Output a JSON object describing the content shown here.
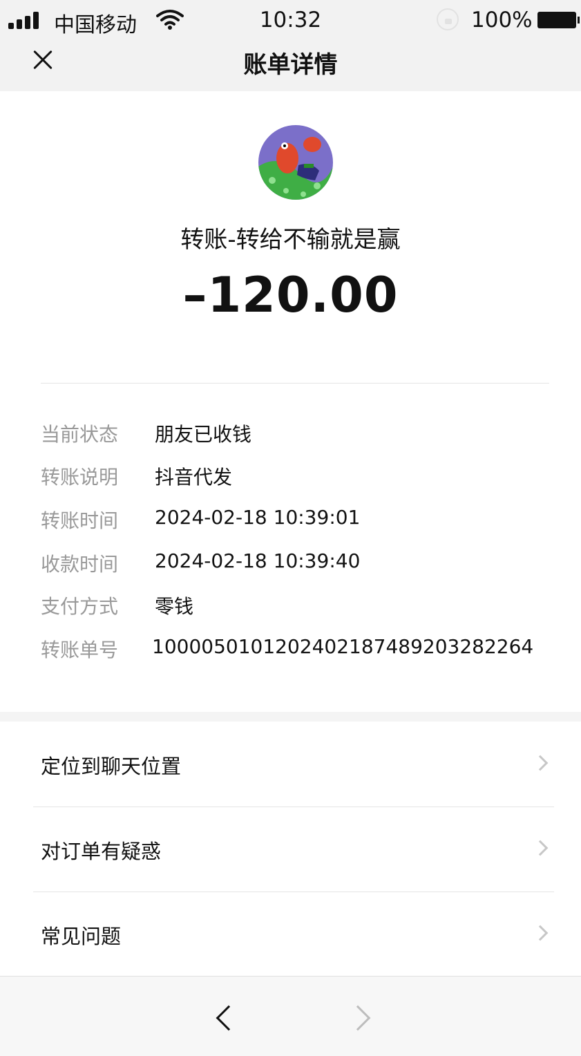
{
  "status_bar": {
    "carrier": "中国移动",
    "time": "10:32",
    "battery_percent": "100%"
  },
  "nav": {
    "title": "账单详情"
  },
  "header": {
    "payee": "转账-转给不输就是赢",
    "amount": "–120.00"
  },
  "details": [
    {
      "label": "当前状态",
      "value": "朋友已收钱"
    },
    {
      "label": "转账说明",
      "value": "抖音代发"
    },
    {
      "label": "转账时间",
      "value": "2024-02-18 10:39:01"
    },
    {
      "label": "收款时间",
      "value": "2024-02-18 10:39:40"
    },
    {
      "label": "支付方式",
      "value": "零钱"
    },
    {
      "label": "转账单号",
      "value": "1000050101202402187489203282264"
    }
  ],
  "menu": [
    {
      "label": "定位到聊天位置"
    },
    {
      "label": "对订单有疑惑"
    },
    {
      "label": "常见问题"
    }
  ],
  "colors": {
    "bar_background": "#f2f2f2",
    "label_gray": "#999999",
    "text": "#111111",
    "divider": "#e5e5e5"
  }
}
